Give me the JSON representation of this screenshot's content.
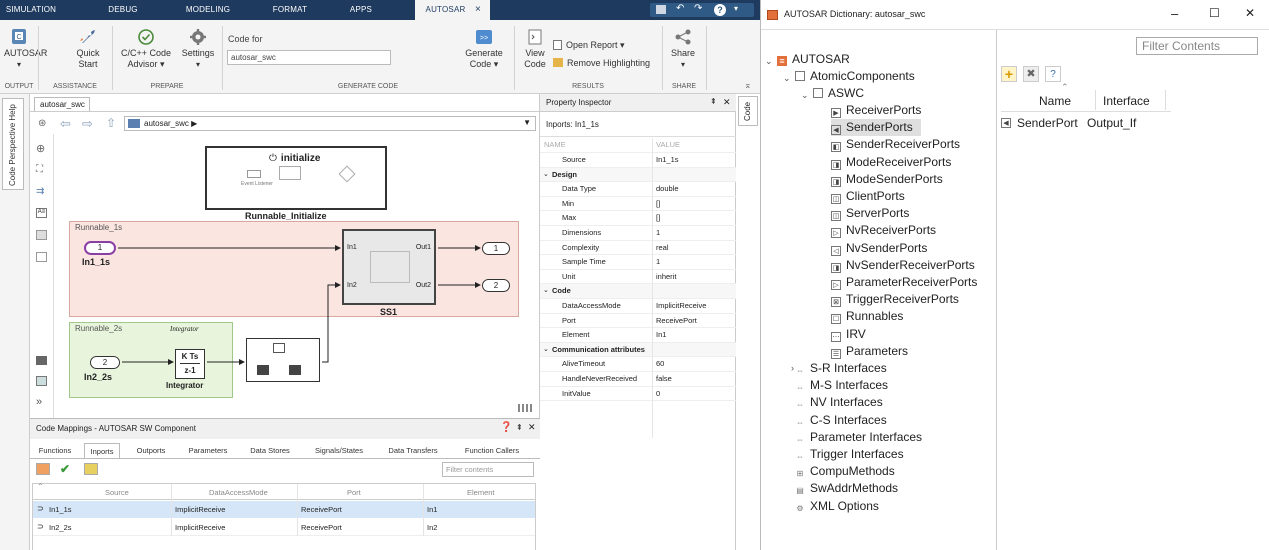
{
  "ribbon": {
    "tabs": [
      "SIMULATION",
      "DEBUG",
      "MODELING",
      "FORMAT",
      "APPS",
      "AUTOSAR"
    ],
    "active_tab": "AUTOSAR",
    "tab_close": "×",
    "buttons": {
      "autosar": "AUTOSAR",
      "quick_start_1": "Quick",
      "quick_start_2": "Start",
      "code_advisor_1": "C/C++ Code",
      "code_advisor_2": "Advisor ▾",
      "settings": "Settings",
      "code_for_label": "Code for",
      "code_for_value": "autosar_swc",
      "generate_code_1": "Generate",
      "generate_code_2": "Code ▾",
      "view_code_1": "View",
      "view_code_2": "Code",
      "open_report": "Open Report  ▾",
      "remove_highlighting": "Remove Highlighting",
      "share": "Share"
    },
    "sections": [
      "OUTPUT",
      "ASSISTANCE",
      "PREPARE",
      "GENERATE CODE",
      "RESULTS",
      "SHARE"
    ]
  },
  "left_dock": {
    "label": "Code Perspective Help"
  },
  "editor": {
    "tab": "autosar_swc",
    "address": "autosar_swc ▶",
    "blocks": {
      "initialize_title": "initialize",
      "initialize_caption": "Runnable_Initialize",
      "event_listener": "Event Listener",
      "runnable_1s": "Runnable_1s",
      "runnable_2s": "Runnable_2s",
      "in1_num": "1",
      "in1_name": "In1_1s",
      "in2_num": "2",
      "in2_name": "In2_2s",
      "ss1_in1": "In1",
      "ss1_in2": "In2",
      "ss1_out1": "Out1",
      "ss1_out2": "Out2",
      "ss1_name": "SS1",
      "out1_num": "1",
      "out2_num": "2",
      "integrator_label": "Integrator",
      "integrator_kts": "K Ts",
      "integrator_z": "z-1",
      "integrator_name": "Integrator"
    }
  },
  "property_inspector": {
    "title": "Property Inspector",
    "subject": "Inports: In1_1s",
    "columns": [
      "NAME",
      "VALUE"
    ],
    "rows": [
      {
        "k": "Source",
        "v": "In1_1s",
        "h": false
      },
      {
        "k": "Design",
        "v": "",
        "h": true
      },
      {
        "k": "Data Type",
        "v": "double",
        "h": false
      },
      {
        "k": "Min",
        "v": "[]",
        "h": false
      },
      {
        "k": "Max",
        "v": "[]",
        "h": false
      },
      {
        "k": "Dimensions",
        "v": "1",
        "h": false
      },
      {
        "k": "Complexity",
        "v": "real",
        "h": false
      },
      {
        "k": "Sample Time",
        "v": "1",
        "h": false
      },
      {
        "k": "Unit",
        "v": "inherit",
        "h": false
      },
      {
        "k": "Code",
        "v": "",
        "h": true
      },
      {
        "k": "DataAccessMode",
        "v": "ImplicitReceive",
        "h": false
      },
      {
        "k": "Port",
        "v": "ReceivePort",
        "h": false
      },
      {
        "k": "Element",
        "v": "In1",
        "h": false
      },
      {
        "k": "Communication attributes",
        "v": "",
        "h": true
      },
      {
        "k": "AliveTimeout",
        "v": "60",
        "h": false
      },
      {
        "k": "HandleNeverReceived",
        "v": "false",
        "h": false
      },
      {
        "k": "InitValue",
        "v": "0",
        "h": false
      }
    ],
    "side_tab": "Code"
  },
  "code_mappings": {
    "title": "Code Mappings - AUTOSAR SW Component",
    "tabs": [
      "Functions",
      "Inports",
      "Outports",
      "Parameters",
      "Data Stores",
      "Signals/States",
      "Data Transfers",
      "Function Callers"
    ],
    "active_tab": "Inports",
    "filter_placeholder": "Filter contents",
    "columns": [
      "Source",
      "DataAccessMode",
      "Port",
      "Element"
    ],
    "rows": [
      {
        "source": "In1_1s",
        "mode": "ImplicitReceive",
        "port": "ReceivePort",
        "element": "In1"
      },
      {
        "source": "In2_2s",
        "mode": "ImplicitReceive",
        "port": "ReceivePort",
        "element": "In2"
      }
    ]
  },
  "dictionary": {
    "title": "AUTOSAR Dictionary: autosar_swc",
    "window_controls": [
      "–",
      "☐",
      "✕"
    ],
    "filter_placeholder": "Filter Contents",
    "tree": {
      "root": "AUTOSAR",
      "atomic": "AtomicComponents",
      "aswc": "ASWC",
      "ports": [
        "ReceiverPorts",
        "SenderPorts",
        "SenderReceiverPorts",
        "ModeReceiverPorts",
        "ModeSenderPorts",
        "ClientPorts",
        "ServerPorts",
        "NvReceiverPorts",
        "NvSenderPorts",
        "NvSenderReceiverPorts",
        "ParameterReceiverPorts",
        "TriggerReceiverPorts",
        "Runnables",
        "IRV",
        "Parameters"
      ],
      "interfaces": [
        "S-R Interfaces",
        "M-S Interfaces",
        "NV Interfaces",
        "C-S Interfaces",
        "Parameter Interfaces",
        "Trigger Interfaces",
        "CompuMethods",
        "SwAddrMethods",
        "XML Options"
      ]
    },
    "table": {
      "columns": [
        "Name",
        "Interface"
      ],
      "rows": [
        {
          "name": "SenderPort",
          "interface": "Output_If"
        }
      ]
    }
  }
}
